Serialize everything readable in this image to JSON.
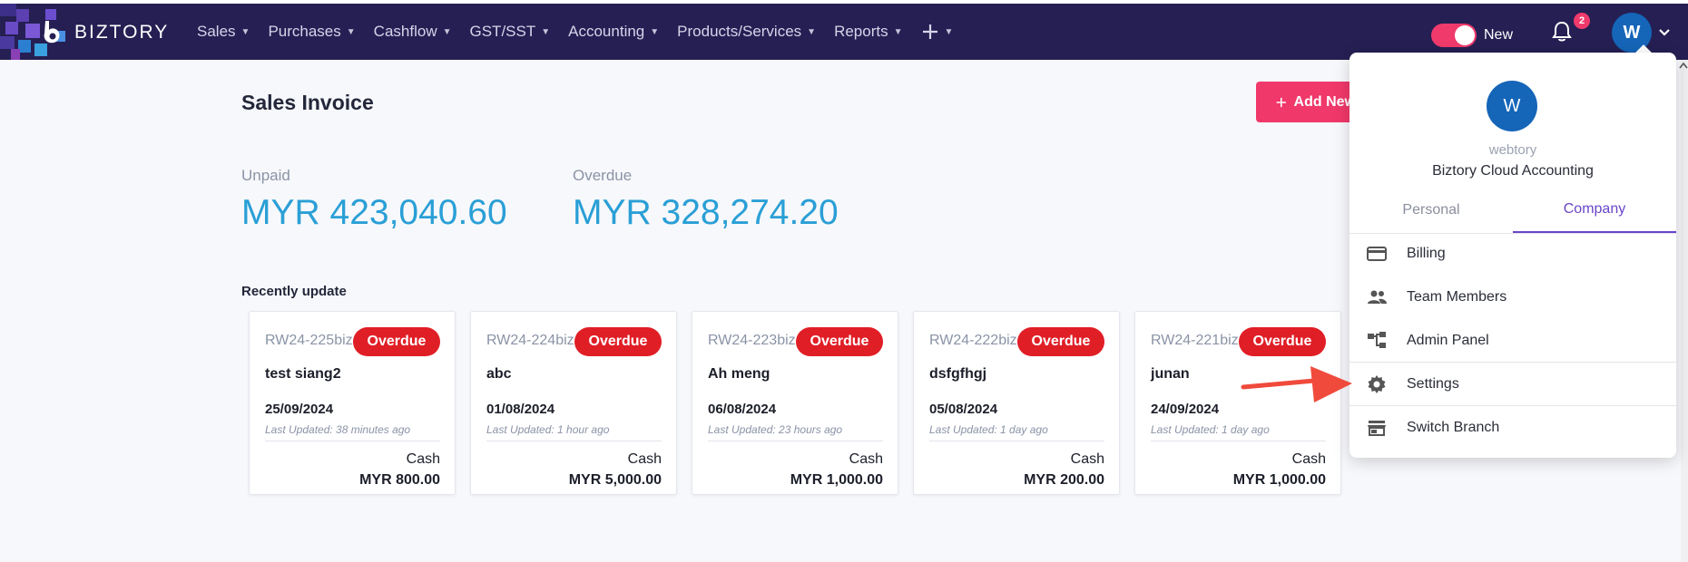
{
  "app": {
    "brand": "BIZTORY",
    "accent_color": "#251f53",
    "primary_button_color": "#f0386a"
  },
  "nav": {
    "items": [
      {
        "label": "Sales"
      },
      {
        "label": "Purchases"
      },
      {
        "label": "Cashflow"
      },
      {
        "label": "GST/SST"
      },
      {
        "label": "Accounting"
      },
      {
        "label": "Products/Services"
      },
      {
        "label": "Reports"
      }
    ],
    "toggle_label": "New",
    "notification_count": "2",
    "avatar_initial": "W"
  },
  "page": {
    "title": "Sales Invoice",
    "add_button": "Add New",
    "unpaid_label": "Unpaid",
    "unpaid_value": "MYR 423,040.60",
    "overdue_label": "Overdue",
    "overdue_value": "MYR 328,274.20",
    "recent_title": "Recently update"
  },
  "cards": [
    {
      "id": "RW24-225biz",
      "status": "Overdue",
      "name": "test siang2",
      "date": "25/09/2024",
      "updated": "Last Updated: 38 minutes ago",
      "method": "Cash",
      "amount": "MYR 800.00"
    },
    {
      "id": "RW24-224biz",
      "status": "Overdue",
      "name": "abc",
      "date": "01/08/2024",
      "updated": "Last Updated: 1 hour ago",
      "method": "Cash",
      "amount": "MYR 5,000.00"
    },
    {
      "id": "RW24-223biz",
      "status": "Overdue",
      "name": "Ah meng",
      "date": "06/08/2024",
      "updated": "Last Updated: 23 hours ago",
      "method": "Cash",
      "amount": "MYR 1,000.00"
    },
    {
      "id": "RW24-222biz",
      "status": "Overdue",
      "name": "dsfgfhgj",
      "date": "05/08/2024",
      "updated": "Last Updated: 1 day ago",
      "method": "Cash",
      "amount": "MYR 200.00"
    },
    {
      "id": "RW24-221biz",
      "status": "Overdue",
      "name": "junan",
      "date": "24/09/2024",
      "updated": "Last Updated: 1 day ago",
      "method": "Cash",
      "amount": "MYR 1,000.00"
    }
  ],
  "menu": {
    "avatar_initial": "W",
    "username": "webtory",
    "company": "Biztory Cloud Accounting",
    "tabs": [
      {
        "label": "Personal",
        "active": false
      },
      {
        "label": "Company",
        "active": true
      }
    ],
    "items": [
      {
        "label": "Billing",
        "icon": "credit-card-icon"
      },
      {
        "label": "Team Members",
        "icon": "people-icon"
      },
      {
        "label": "Admin Panel",
        "icon": "hierarchy-icon"
      },
      {
        "label": "Settings",
        "icon": "gear-icon"
      },
      {
        "label": "Switch Branch",
        "icon": "store-icon"
      }
    ]
  }
}
